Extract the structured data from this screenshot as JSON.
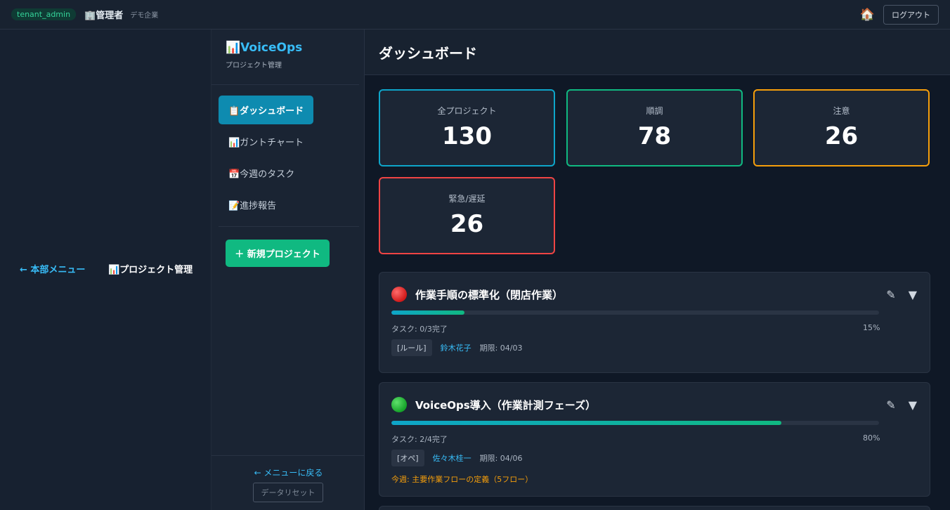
{
  "topbar": {
    "role": "tenant_admin",
    "admin": "🏢管理者",
    "tenant": "デモ企業",
    "home_icon": "🏠",
    "logout": "ログアウト"
  },
  "rail": {
    "back": "← 本部メニュー",
    "project": "📊プロジェクト管理"
  },
  "sidebar": {
    "brand_title": "📊VoiceOps",
    "brand_sub": "プロジェクト管理",
    "items": [
      {
        "label": "📋ダッシュボード"
      },
      {
        "label": "📊ガントチャート"
      },
      {
        "label": "📅今週のタスク"
      },
      {
        "label": "📝進捗報告"
      }
    ],
    "new_project": "＋ 新規プロジェクト",
    "back_menu": "← メニューに戻る",
    "data_reset": "データリセット"
  },
  "main": {
    "title": "ダッシュボード",
    "stats": [
      {
        "label": "全プロジェクト",
        "value": "130",
        "color": "#0ea5c9"
      },
      {
        "label": "順調",
        "value": "78",
        "color": "#10b981"
      },
      {
        "label": "注意",
        "value": "26",
        "color": "#f59e0b"
      },
      {
        "label": "緊急/遅延",
        "value": "26",
        "color": "#ef4444"
      }
    ],
    "projects": [
      {
        "title": "作業手順の標準化（閉店作業）",
        "status": "red",
        "progress": 15,
        "tasks": "タスク: 0/3完了",
        "percent": "15%",
        "tag": "[ルール]",
        "owner": "鈴木花子",
        "due": "期限: 04/03",
        "weekly": ""
      },
      {
        "title": "VoiceOps導入（作業計測フェーズ）",
        "status": "green",
        "progress": 80,
        "tasks": "タスク: 2/4完了",
        "percent": "80%",
        "tag": "[オペ]",
        "owner": "佐々木桂一",
        "due": "期限: 04/06",
        "weekly": "今週: 主要作業フローの定義（5フロー）"
      }
    ],
    "edit_icon": "✎",
    "expand_icon": "▼"
  }
}
